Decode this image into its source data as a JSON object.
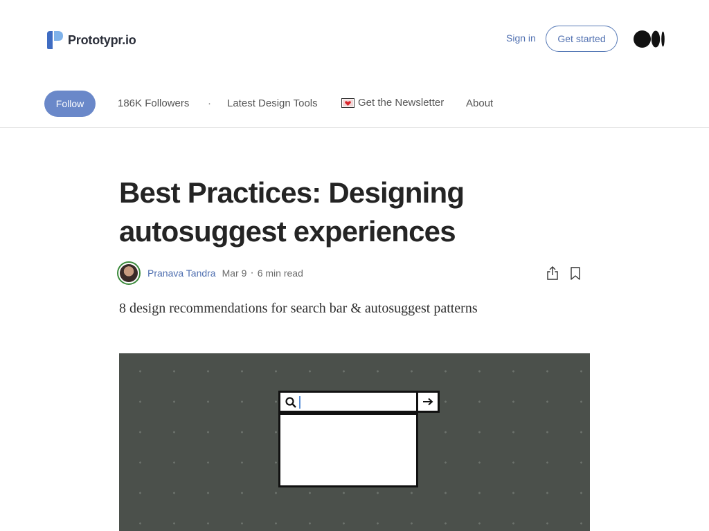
{
  "header": {
    "brand_name": "Prototypr.io",
    "sign_in": "Sign in",
    "get_started": "Get started"
  },
  "pubnav": {
    "follow": "Follow",
    "followers": "186K Followers",
    "separator": "·",
    "links": [
      "Latest Design Tools",
      "Get the Newsletter",
      "About"
    ]
  },
  "article": {
    "title": "Best Practices: Designing autosuggest experiences",
    "author": "Pranava Tandra",
    "date": "Mar 9",
    "meta_separator": "·",
    "read_time": "6 min read",
    "subtitle": "8 design recommendations for search bar & autosuggest patterns"
  },
  "colors": {
    "accent": "#6a88c9",
    "link": "#4f6fb0",
    "hero_bg": "#4b504b",
    "avatar_ring": "#3b8a3b"
  },
  "icons": [
    "prototypr-logo",
    "medium-logo",
    "envelope-heart-icon",
    "share-icon",
    "bookmark-icon",
    "search-icon",
    "arrow-right-icon"
  ]
}
